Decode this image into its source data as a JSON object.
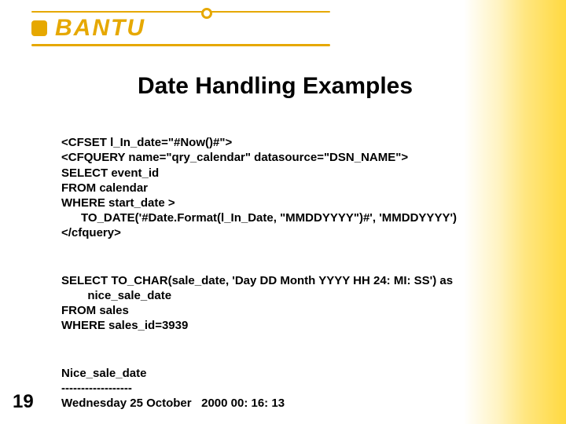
{
  "logo": {
    "text": "BANTU"
  },
  "title": "Date Handling Examples",
  "code1": "<CFSET l_In_date=\"#Now()#\">\n<CFQUERY name=\"qry_calendar\" datasource=\"DSN_NAME\">\nSELECT event_id\nFROM calendar\nWHERE start_date >\n      TO_DATE('#Date.Format(l_In_Date, \"MMDDYYYY\")#', 'MMDDYYYY')\n</cfquery>",
  "code2": "SELECT TO_CHAR(sale_date, 'Day DD Month YYYY HH 24: MI: SS') as\n        nice_sale_date\nFROM sales\nWHERE sales_id=3939",
  "code3": "Nice_sale_date\n------------------\nWednesday 25 October   2000 00: 16: 13",
  "page_number": "19"
}
